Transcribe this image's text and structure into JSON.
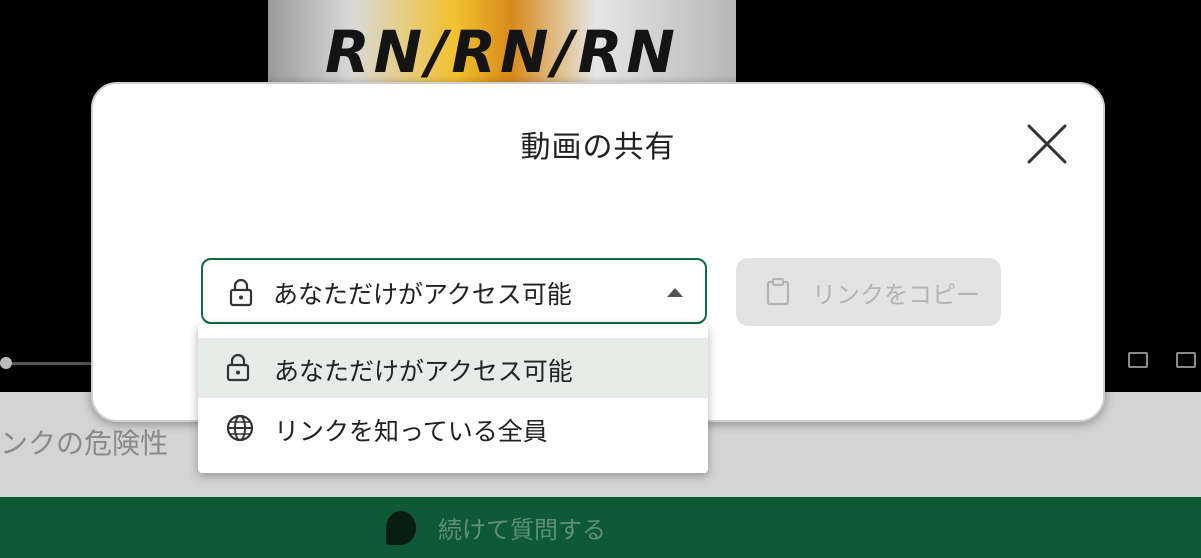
{
  "background": {
    "thumbnail_text": "RN/RN/RN",
    "content_text": "ンクの危険性",
    "action_bar_label": "続けて質問する"
  },
  "modal": {
    "title": "動画の共有",
    "close_icon": "close-icon",
    "access_select": {
      "value": "あなただけがアクセス可能",
      "icon": "lock-icon",
      "expanded": true
    },
    "copy_link_button": {
      "label": "リンクをコピー",
      "icon": "clipboard-icon",
      "disabled": true
    },
    "dropdown": {
      "options": [
        {
          "label": "あなただけがアクセス可能",
          "icon": "lock-icon",
          "selected": true
        },
        {
          "label": "リンクを知っている全員",
          "icon": "globe-icon",
          "selected": false
        }
      ]
    }
  },
  "colors": {
    "accent_green": "#0d6b3f",
    "selected_option_bg": "#e6ede9",
    "disabled_button_bg": "#e3e3e3"
  }
}
